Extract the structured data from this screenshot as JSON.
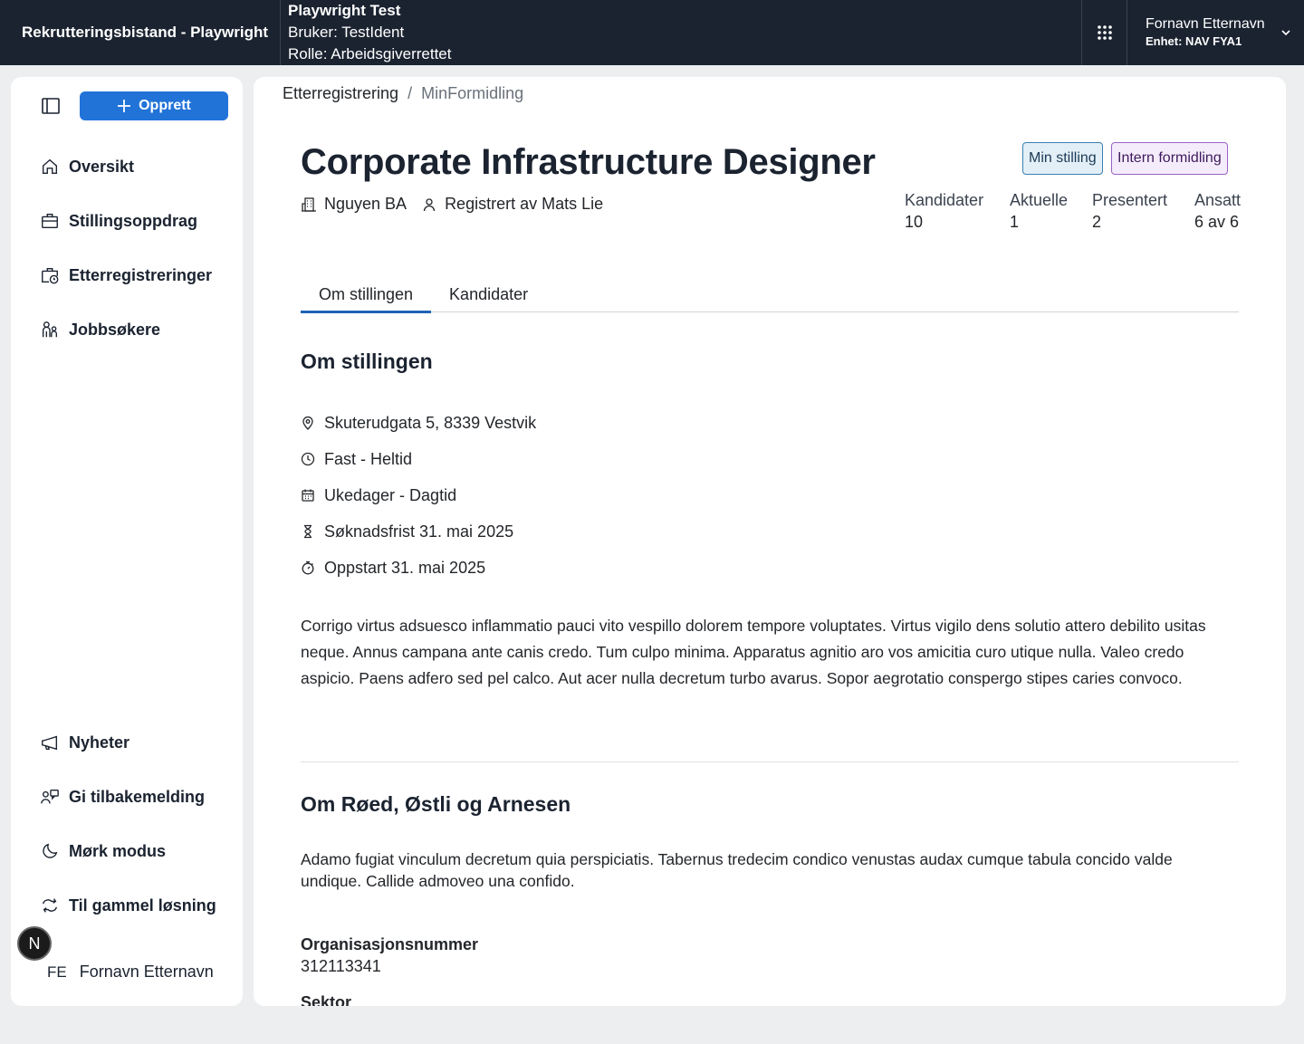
{
  "header": {
    "app_title": "Rekrutteringsbistand - Playwright",
    "env_name": "Playwright Test",
    "env_user": "Bruker: TestIdent",
    "env_role": "Rolle: Arbeidsgiverrettet",
    "user_name": "Fornavn Etternavn",
    "user_unit": "Enhet: NAV FYA1"
  },
  "sidebar": {
    "create_label": "Opprett",
    "items": [
      {
        "label": "Oversikt",
        "icon": "house-icon"
      },
      {
        "label": "Stillingsoppdrag",
        "icon": "briefcase-icon"
      },
      {
        "label": "Etterregistreringer",
        "icon": "briefcase-clock-icon"
      },
      {
        "label": "Jobbsøkere",
        "icon": "people-icon"
      }
    ],
    "bottom_items": [
      {
        "label": "Nyheter",
        "icon": "megaphone-icon"
      },
      {
        "label": "Gi tilbakemelding",
        "icon": "person-chat-icon"
      },
      {
        "label": "Mørk modus",
        "icon": "moon-icon"
      },
      {
        "label": "Til gammel løsning",
        "icon": "arrows-circle-icon"
      }
    ],
    "user_initials": "FE",
    "user_name": "Fornavn Etternavn",
    "floating_badge": "N"
  },
  "breadcrumb": {
    "parent": "Etterregistrering",
    "separator": "/",
    "current": "MinFormidling"
  },
  "job": {
    "title": "Corporate Infrastructure Designer",
    "employer": "Nguyen BA",
    "registered_by": "Registrert av Mats Lie",
    "tags": {
      "own": "Min stilling",
      "intern": "Intern formidling"
    },
    "stats": [
      {
        "label": "Kandidater",
        "value": "10"
      },
      {
        "label": "Aktuelle",
        "value": "1"
      },
      {
        "label": "Presentert",
        "value": "2"
      },
      {
        "label": "Ansatt",
        "value": "6 av 6"
      }
    ]
  },
  "tabs": [
    {
      "label": "Om stillingen",
      "active": true
    },
    {
      "label": "Kandidater",
      "active": false
    }
  ],
  "about": {
    "heading": "Om stillingen",
    "facts": [
      {
        "text": "Skuterudgata 5, 8339 Vestvik",
        "icon": "location-pin-icon"
      },
      {
        "text": "Fast - Heltid",
        "icon": "clock-icon"
      },
      {
        "text": "Ukedager - Dagtid",
        "icon": "calendar-icon"
      },
      {
        "text": "Søknadsfrist 31. mai 2025",
        "icon": "hourglass-icon"
      },
      {
        "text": "Oppstart 31. mai 2025",
        "icon": "stopwatch-icon"
      }
    ],
    "description": "Corrigo virtus adsuesco inflammatio pauci vito vespillo dolorem tempore voluptates. Virtus vigilo dens solutio attero debilito usitas neque. Annus campana ante canis credo. Tum culpo minima. Apparatus agnitio aro vos amicitia curo utique nulla. Valeo credo aspicio. Paens adfero sed pel calco. Aut acer nulla decretum turbo avarus. Sopor aegrotatio conspergo stipes caries convoco."
  },
  "employer": {
    "heading": "Om Røed, Østli og Arnesen",
    "description": "Adamo fugiat vinculum decretum quia perspiciatis. Tabernus tredecim condico venustas audax cumque tabula concido valde undique. Callide admoveo una confido.",
    "org_label": "Organisasjonsnummer",
    "org_value": "312113341",
    "sector_label": "Sektor"
  }
}
